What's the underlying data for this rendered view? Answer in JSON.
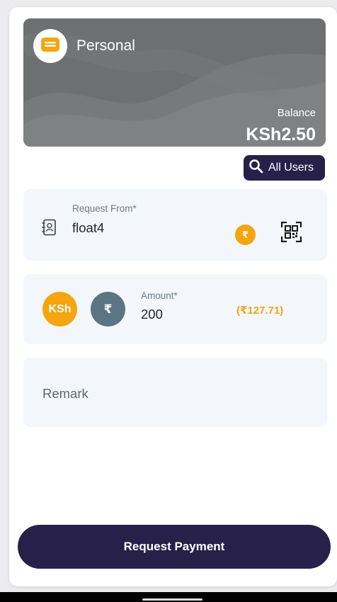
{
  "wallet": {
    "name": "Personal",
    "balance_label": "Balance",
    "balance_value": "KSh2.50",
    "icon": "wallet-icon",
    "card_color": "#6e7072",
    "icon_color": "#f4a50f"
  },
  "all_users": {
    "label": "All Users",
    "icon": "search-icon"
  },
  "request_from": {
    "label": "Request From*",
    "value": "float4",
    "icon": "contact-book-icon",
    "coin_symbol": "₹",
    "qr_icon": "qr-code-icon"
  },
  "amount": {
    "label": "Amount*",
    "value": "200",
    "currency_primary": "KSh",
    "currency_secondary": "₹",
    "converted": "(₹127.71)"
  },
  "remark": {
    "placeholder": "Remark"
  },
  "submit": {
    "label": "Request Payment"
  },
  "colors": {
    "accent_dark": "#272149",
    "accent_orange": "#f4a50f",
    "field_background": "#f3f7fb",
    "inr_badge": "#5c7584"
  }
}
